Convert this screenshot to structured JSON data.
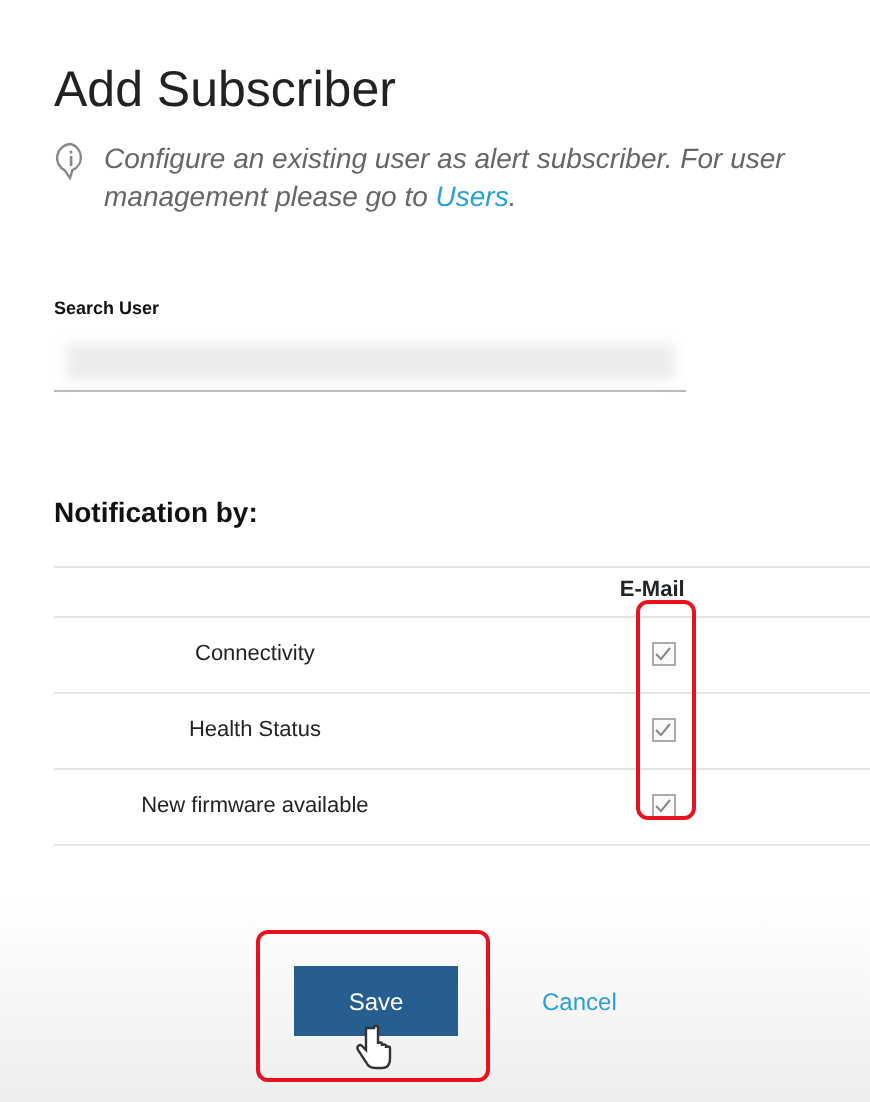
{
  "title": "Add Subscriber",
  "info": {
    "text": "Configure an existing user as alert subscriber. For user management please go to ",
    "link": "Users",
    "after": "."
  },
  "search": {
    "label": "Search User",
    "value_blurred": true
  },
  "notification": {
    "heading": "Notification by:",
    "channel": "E-Mail",
    "channel_highlighted": true,
    "rows": [
      {
        "label": "Connectivity",
        "checked": true
      },
      {
        "label": "Health Status",
        "checked": true
      },
      {
        "label": "New firmware available",
        "checked": true
      }
    ]
  },
  "footer": {
    "save": "Save",
    "save_highlighted": true,
    "cancel": "Cancel"
  }
}
